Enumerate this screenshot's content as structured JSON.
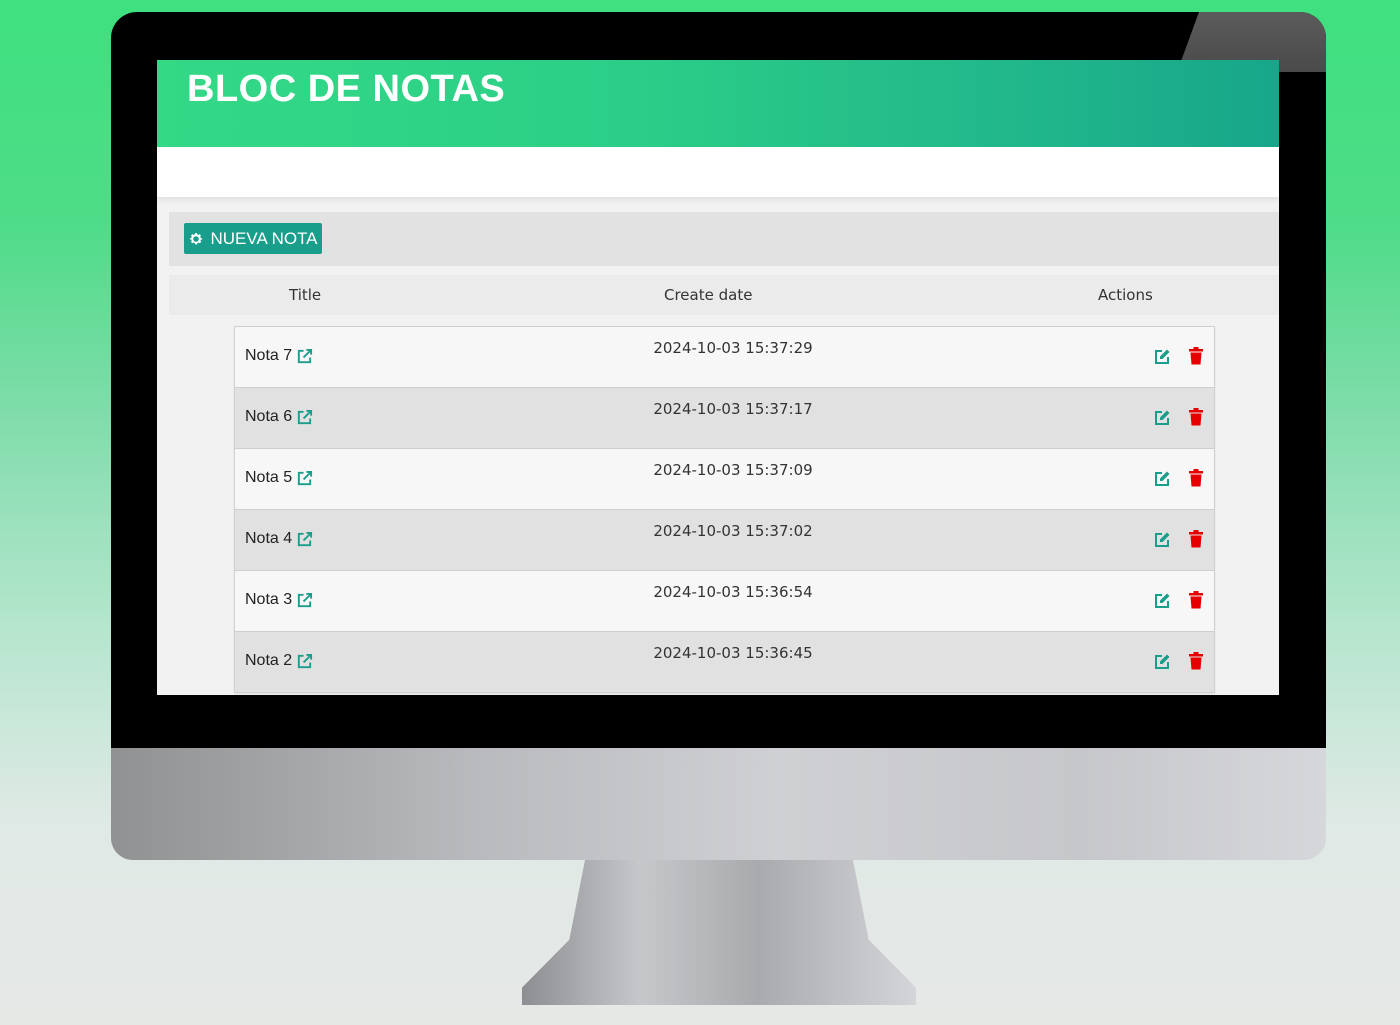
{
  "app": {
    "title": "BLOC DE NOTAS"
  },
  "toolbar": {
    "new_note_label": "NUEVA NOTA"
  },
  "table": {
    "headers": {
      "title": "Title",
      "create_date": "Create date",
      "actions": "Actions"
    },
    "rows": [
      {
        "title": "Nota 7",
        "date": "2024-10-03 15:37:29"
      },
      {
        "title": "Nota 6",
        "date": "2024-10-03 15:37:17"
      },
      {
        "title": "Nota 5",
        "date": "2024-10-03 15:37:09"
      },
      {
        "title": "Nota 4",
        "date": "2024-10-03 15:37:02"
      },
      {
        "title": "Nota 3",
        "date": "2024-10-03 15:36:54"
      },
      {
        "title": "Nota 2",
        "date": "2024-10-03 15:36:45"
      }
    ]
  },
  "icons": {
    "new_note": "gear-icon",
    "open": "external-link-icon",
    "edit": "edit-icon",
    "delete": "trash-icon"
  },
  "colors": {
    "accent": "#1a9e8c",
    "danger": "#e60000",
    "header_start": "#33d985",
    "header_end": "#17a68a"
  }
}
